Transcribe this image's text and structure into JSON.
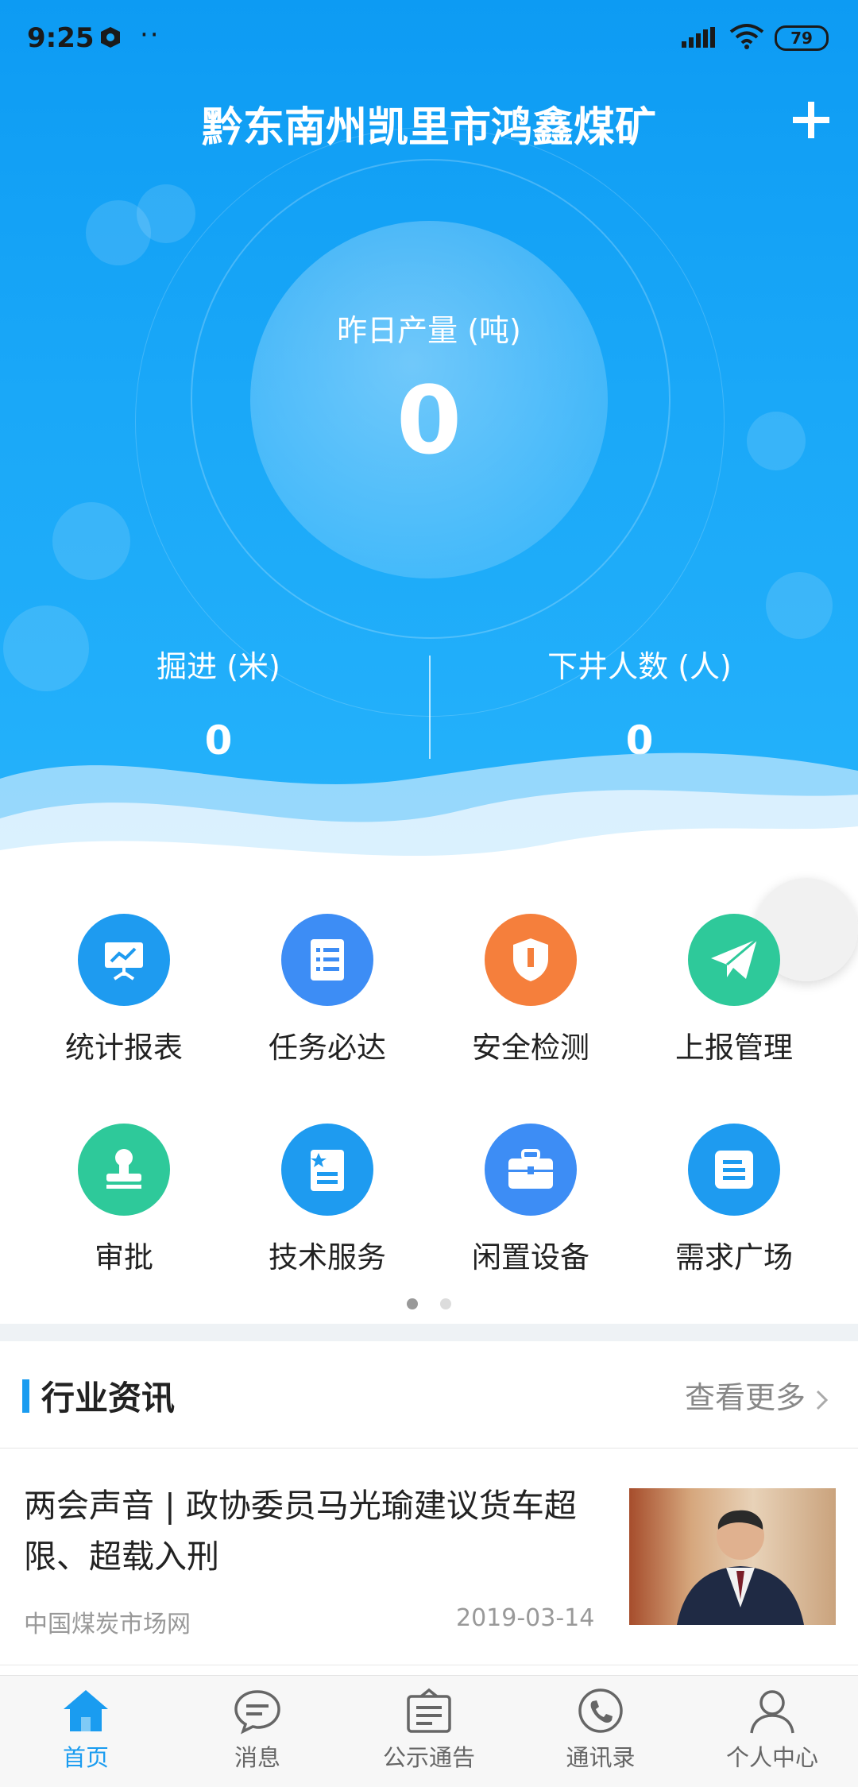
{
  "status_bar": {
    "time": "9:25",
    "dots": "··",
    "battery": "79"
  },
  "header": {
    "title": "黔东南州凯里市鸿鑫煤矿"
  },
  "production": {
    "label": "昨日产量 (吨)",
    "value": "0"
  },
  "stats": [
    {
      "label": "掘进 (米)",
      "value": "0"
    },
    {
      "label": "下井人数 (人)",
      "value": "0"
    }
  ],
  "grid": [
    {
      "label": "统计报表",
      "icon": "presentation-chart-icon",
      "color": "#1e9bf0"
    },
    {
      "label": "任务必达",
      "icon": "task-list-icon",
      "color": "#3d8df5"
    },
    {
      "label": "安全检测",
      "icon": "shield-icon",
      "color": "#f57f3c"
    },
    {
      "label": "上报管理",
      "icon": "paper-plane-icon",
      "color": "#2ec99a"
    },
    {
      "label": "审批",
      "icon": "stamp-icon",
      "color": "#2ec99a"
    },
    {
      "label": "技术服务",
      "icon": "document-star-icon",
      "color": "#1e9bf0"
    },
    {
      "label": "闲置设备",
      "icon": "toolbox-icon",
      "color": "#3d8df5"
    },
    {
      "label": "需求广场",
      "icon": "note-icon",
      "color": "#1e9bf0"
    }
  ],
  "pager": {
    "active": 1,
    "total": 2
  },
  "news": {
    "section_title": "行业资讯",
    "more_label": "查看更多",
    "items": [
      {
        "title": "两会声音 | 政协委员马光瑜建议货车超限、超载入刑",
        "source": "中国煤炭市场网",
        "date": "2019-03-14"
      }
    ]
  },
  "tabbar": [
    {
      "label": "首页",
      "icon": "home-icon",
      "active": true
    },
    {
      "label": "消息",
      "icon": "chat-bubble-icon",
      "active": false
    },
    {
      "label": "公示通告",
      "icon": "notice-board-icon",
      "active": false
    },
    {
      "label": "通讯录",
      "icon": "phone-icon",
      "active": false
    },
    {
      "label": "个人中心",
      "icon": "user-icon",
      "active": false
    }
  ],
  "colors": {
    "primary": "#1a9cf0",
    "hero_top": "#0d9bf3",
    "hero_bottom": "#26b3fb"
  }
}
